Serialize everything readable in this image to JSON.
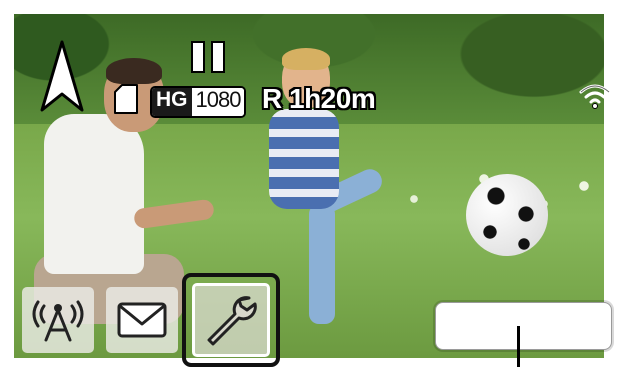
{
  "recording": {
    "quality_badge": "HG",
    "resolution": "1080",
    "remaining_time": "R 1h20m",
    "state": "paused"
  },
  "icons": {
    "north_arrow": "north-arrow-icon",
    "pause": "pause-icon",
    "sd_card": "sd-card-icon",
    "wifi": "wifi-icon",
    "remote": "remote-antenna-icon",
    "mail": "mail-icon",
    "settings": "wrench-icon"
  },
  "toolbar": {
    "selected": "settings"
  },
  "colors": {
    "overlay_text": "#ffffff",
    "outline": "#000000",
    "badge_dark": "#1a1a1a"
  }
}
